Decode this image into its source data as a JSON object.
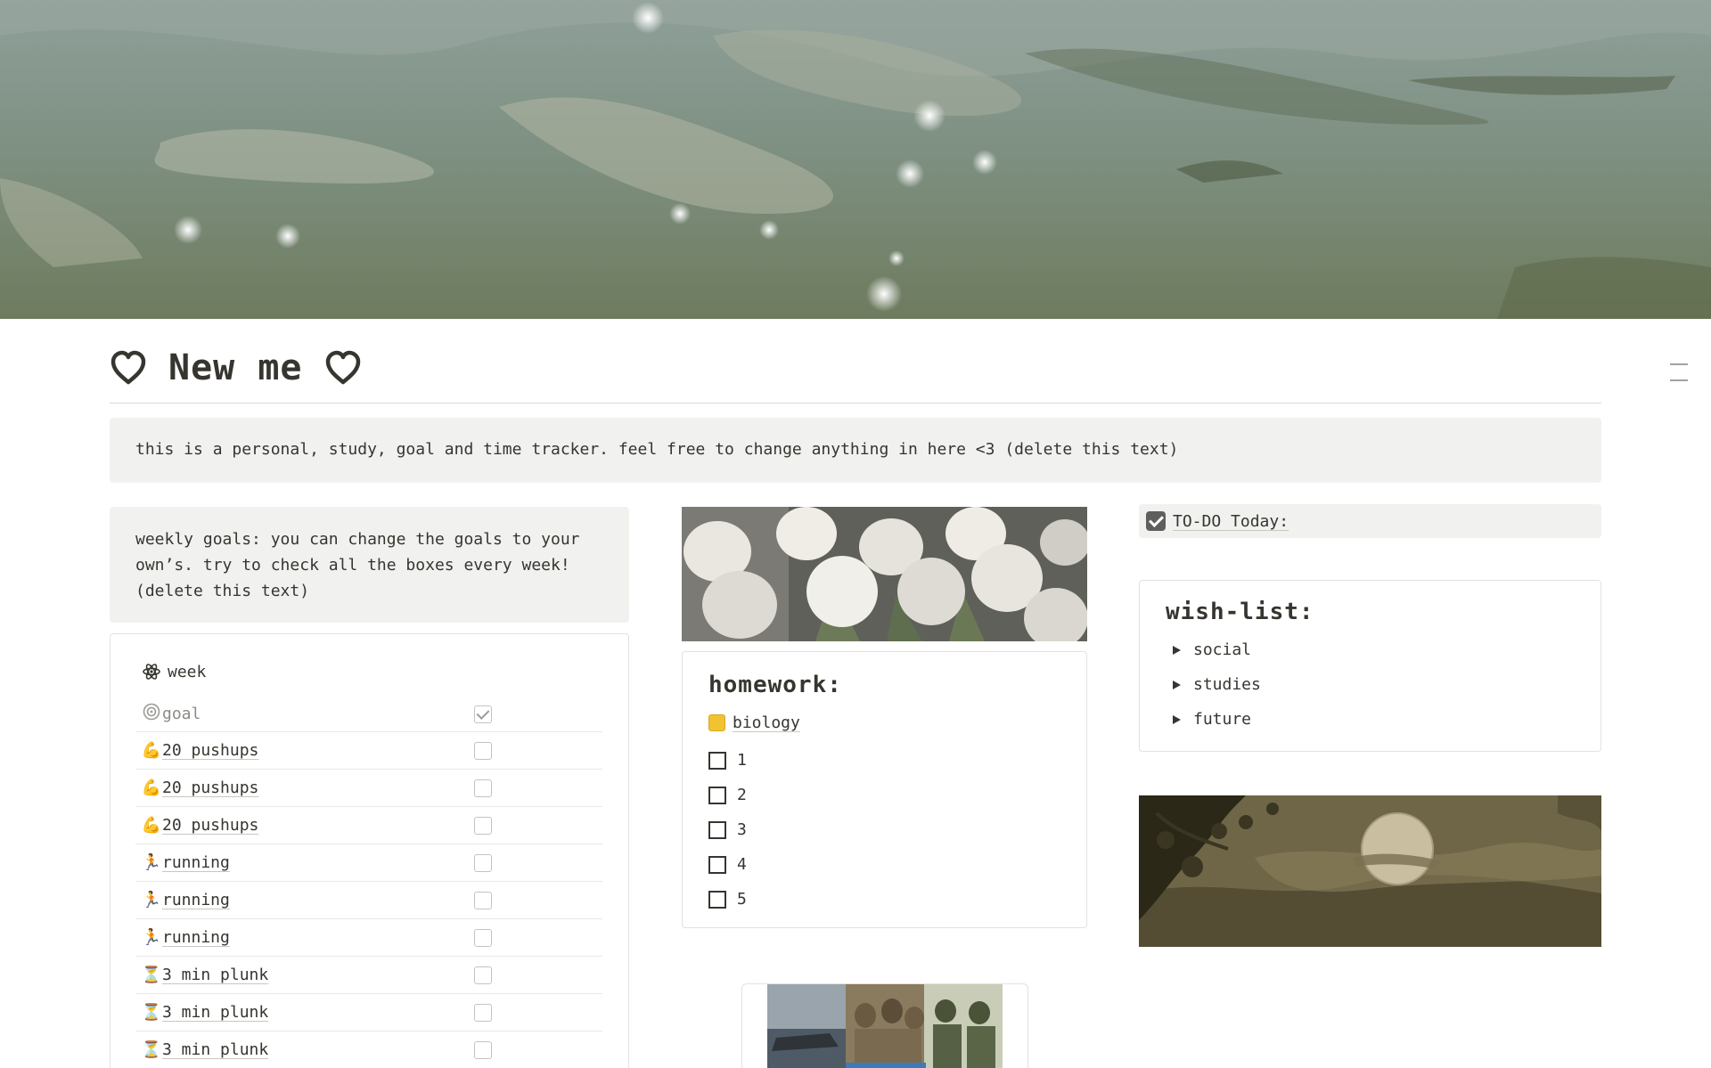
{
  "page": {
    "title": "New me",
    "title_icon": "heart-outline-icon"
  },
  "intro_callout": {
    "text": "this is a personal, study, goal and time tracker. feel free to change anything in here <3 (delete this text)"
  },
  "weekly_callout": {
    "text": "weekly goals: you can change the goals to your own’s. try to check all the boxes every week! (delete this text)"
  },
  "goals": {
    "view_icon": "atom-icon",
    "view_name": "week",
    "header": {
      "icon": "target-icon",
      "label": "goal",
      "checkbox_checked": true
    },
    "rows": [
      {
        "emoji": "💪",
        "icon": "flexed-bicep-icon",
        "label": "20 pushups",
        "checked": false
      },
      {
        "emoji": "💪",
        "icon": "flexed-bicep-icon",
        "label": "20 pushups",
        "checked": false
      },
      {
        "emoji": "💪",
        "icon": "flexed-bicep-icon",
        "label": "20 pushups",
        "checked": false
      },
      {
        "emoji": "🏃",
        "icon": "runner-icon",
        "label": "running",
        "checked": false
      },
      {
        "emoji": "🏃",
        "icon": "runner-icon",
        "label": "running",
        "checked": false
      },
      {
        "emoji": "🏃",
        "icon": "runner-icon",
        "label": "running",
        "checked": false
      },
      {
        "emoji": "⏳",
        "icon": "hourglass-icon",
        "label": "3 min plunk",
        "checked": false
      },
      {
        "emoji": "⏳",
        "icon": "hourglass-icon",
        "label": "3 min plunk",
        "checked": false
      },
      {
        "emoji": "⏳",
        "icon": "hourglass-icon",
        "label": "3 min plunk",
        "checked": false
      }
    ]
  },
  "homework": {
    "heading": "homework:",
    "subpage_icon": "notepad-icon",
    "subpage": "biology",
    "todos": [
      "1",
      "2",
      "3",
      "4",
      "5"
    ]
  },
  "todo_today": {
    "icon": "checkbox-emoji-icon",
    "label": "TO-DO Today:"
  },
  "wishlist": {
    "heading": "wish-list:",
    "toggles": [
      "social",
      "studies",
      "future"
    ]
  },
  "colors": {
    "text": "#37352f",
    "callout_bg": "#f1f1ef",
    "border": "#e3e2df",
    "muted": "#8c8b87"
  }
}
